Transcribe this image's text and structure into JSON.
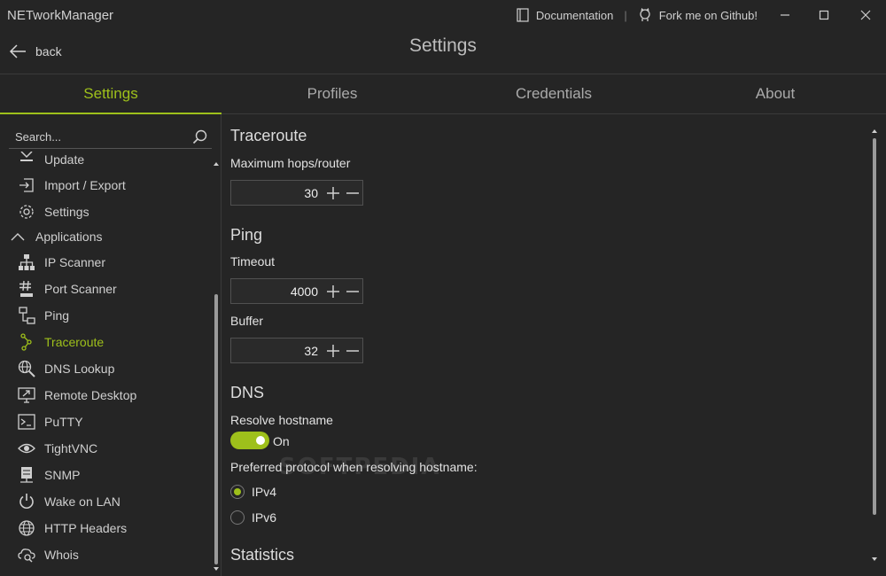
{
  "app": {
    "title": "NETworkManager"
  },
  "titlebar": {
    "documentation": "Documentation",
    "separator": "|",
    "github": "Fork me on Github!"
  },
  "header": {
    "back_label": "back",
    "page_title": "Settings"
  },
  "tabs": [
    {
      "label": "Settings",
      "active": true
    },
    {
      "label": "Profiles"
    },
    {
      "label": "Credentials"
    },
    {
      "label": "About"
    }
  ],
  "sidebar": {
    "search_placeholder": "Search...",
    "items": [
      {
        "label": "Update",
        "icon": "download-icon"
      },
      {
        "label": "Import / Export",
        "icon": "import-icon"
      },
      {
        "label": "Settings",
        "icon": "gear-icon"
      },
      {
        "label": "Applications",
        "icon": "chevron-up-icon",
        "group": true
      },
      {
        "label": "IP Scanner",
        "icon": "network-icon"
      },
      {
        "label": "Port Scanner",
        "icon": "hash-icon"
      },
      {
        "label": "Ping",
        "icon": "ping-icon"
      },
      {
        "label": "Traceroute",
        "icon": "traceroute-icon",
        "active": true
      },
      {
        "label": "DNS Lookup",
        "icon": "globe-search-icon"
      },
      {
        "label": "Remote Desktop",
        "icon": "remote-desktop-icon"
      },
      {
        "label": "PuTTY",
        "icon": "terminal-icon"
      },
      {
        "label": "TightVNC",
        "icon": "eye-icon"
      },
      {
        "label": "SNMP",
        "icon": "server-icon"
      },
      {
        "label": "Wake on LAN",
        "icon": "power-icon"
      },
      {
        "label": "HTTP Headers",
        "icon": "globe-icon"
      },
      {
        "label": "Whois",
        "icon": "cloud-search-icon"
      }
    ]
  },
  "content": {
    "traceroute": {
      "title": "Traceroute",
      "max_hops_label": "Maximum hops/router",
      "max_hops_value": "30"
    },
    "ping": {
      "title": "Ping",
      "timeout_label": "Timeout",
      "timeout_value": "4000",
      "buffer_label": "Buffer",
      "buffer_value": "32"
    },
    "dns": {
      "title": "DNS",
      "resolve_label": "Resolve hostname",
      "resolve_state": "On",
      "protocol_label": "Preferred protocol when resolving hostname:",
      "ipv4": "IPv4",
      "ipv6": "IPv6"
    },
    "statistics": {
      "title": "Statistics"
    }
  },
  "watermark": "SOFTPEDIA",
  "colors": {
    "accent": "#9ec01b",
    "background": "#252525"
  }
}
